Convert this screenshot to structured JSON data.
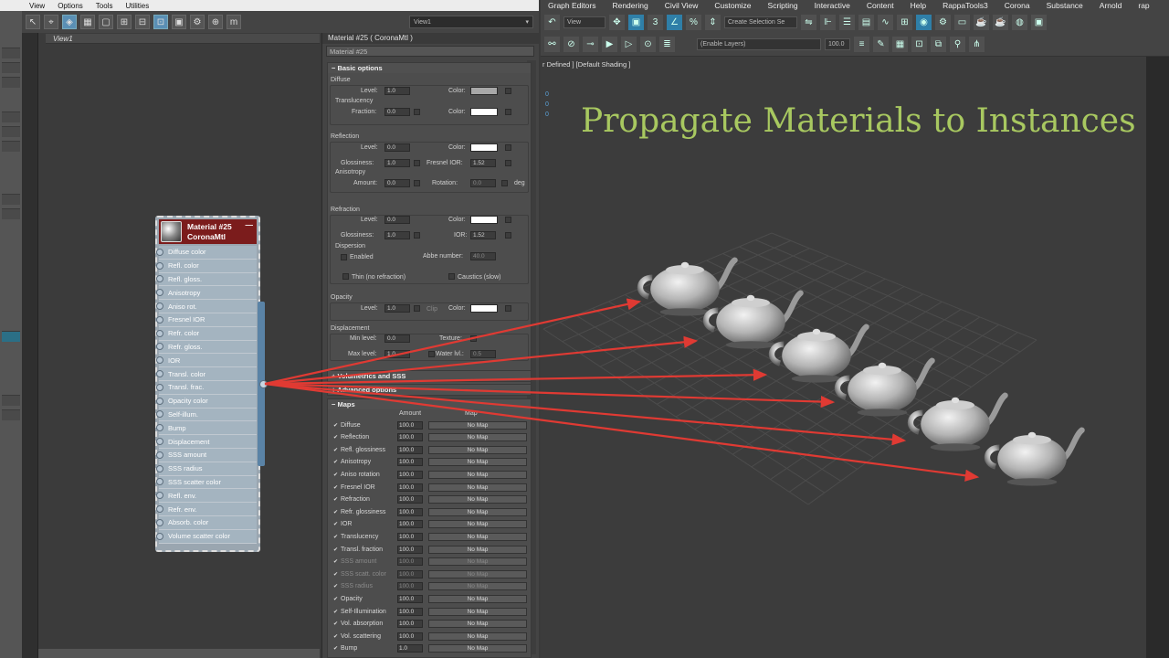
{
  "left_menu": [
    "View",
    "Options",
    "Tools",
    "Utilities"
  ],
  "view_select": "View1",
  "view_tab": "View1",
  "node": {
    "title": "Material #25",
    "type": "CoronaMtl",
    "minimize": "—",
    "slots": [
      "Diffuse color",
      "Refl. color",
      "Refl. gloss.",
      "Anisotropy",
      "Aniso rot.",
      "Fresnel IOR",
      "Refr. color",
      "Refr. gloss.",
      "IOR",
      "Transl. color",
      "Transl. frac.",
      "Opacity color",
      "Self-illum.",
      "Bump",
      "Displacement",
      "SSS amount",
      "SSS radius",
      "SSS scatter color",
      "Refl. env.",
      "Refr. env.",
      "Absorb. color",
      "Volume scatter color"
    ]
  },
  "panel": {
    "title": "Material #25  ( CoronaMtl )",
    "name": "Material #25",
    "basic_options": "Basic options",
    "diffuse": {
      "group": "Diffuse",
      "level_label": "Level:",
      "level": "1.0",
      "color_label": "Color:"
    },
    "translucency": {
      "group": "Translucency",
      "fraction_label": "Fraction:",
      "fraction": "0.0",
      "color_label": "Color:"
    },
    "reflection": {
      "group": "Reflection",
      "level_label": "Level:",
      "level": "0.0",
      "color_label": "Color:",
      "gloss_label": "Glossiness:",
      "gloss": "1.0",
      "fresnel_label": "Fresnel IOR:",
      "fresnel": "1.52",
      "aniso_group": "Anisotropy",
      "amount_label": "Amount:",
      "amount": "0.0",
      "rotation_label": "Rotation:",
      "rotation": "0.0",
      "deg": "deg"
    },
    "refraction": {
      "group": "Refraction",
      "level_label": "Level:",
      "level": "0.0",
      "color_label": "Color:",
      "gloss_label": "Glossiness:",
      "gloss": "1.0",
      "ior_label": "IOR:",
      "ior": "1.52",
      "dispersion_group": "Dispersion",
      "enabled": "Enabled",
      "abbe_label": "Abbe number:",
      "abbe": "40.0",
      "thin": "Thin (no refraction)",
      "caustics": "Caustics (slow)"
    },
    "opacity": {
      "group": "Opacity",
      "level_label": "Level:",
      "level": "1.0",
      "clip": "Clip",
      "color_label": "Color:"
    },
    "displacement": {
      "group": "Displacement",
      "min_label": "Min level:",
      "min": "0.0",
      "texture_label": "Texture:",
      "max_label": "Max level:",
      "max": "1.0",
      "water_label": "Water lvl.:",
      "water": "0.5"
    },
    "volumetrics": "Volumetrics and SSS",
    "advanced": "Advanced options",
    "maps_title": "Maps",
    "maps_amount_header": "Amount",
    "maps_map_header": "Map",
    "maps": [
      {
        "name": "Diffuse",
        "amount": "100.0",
        "map": "No Map",
        "dim": false
      },
      {
        "name": "Reflection",
        "amount": "100.0",
        "map": "No Map",
        "dim": false
      },
      {
        "name": "Refl. glossiness",
        "amount": "100.0",
        "map": "No Map",
        "dim": false
      },
      {
        "name": "Anisotropy",
        "amount": "100.0",
        "map": "No Map",
        "dim": false
      },
      {
        "name": "Aniso rotation",
        "amount": "100.0",
        "map": "No Map",
        "dim": false
      },
      {
        "name": "Fresnel IOR",
        "amount": "100.0",
        "map": "No Map",
        "dim": false
      },
      {
        "name": "Refraction",
        "amount": "100.0",
        "map": "No Map",
        "dim": false
      },
      {
        "name": "Refr. glossiness",
        "amount": "100.0",
        "map": "No Map",
        "dim": false
      },
      {
        "name": "IOR",
        "amount": "100.0",
        "map": "No Map",
        "dim": false
      },
      {
        "name": "Translucency",
        "amount": "100.0",
        "map": "No Map",
        "dim": false
      },
      {
        "name": "Transl. fraction",
        "amount": "100.0",
        "map": "No Map",
        "dim": false
      },
      {
        "name": "SSS amount",
        "amount": "100.0",
        "map": "No Map",
        "dim": true
      },
      {
        "name": "SSS scatt. color",
        "amount": "100.0",
        "map": "No Map",
        "dim": true
      },
      {
        "name": "SSS radius",
        "amount": "100.0",
        "map": "No Map",
        "dim": true
      },
      {
        "name": "Opacity",
        "amount": "100.0",
        "map": "No Map",
        "dim": false
      },
      {
        "name": "Self-Illumination",
        "amount": "100.0",
        "map": "No Map",
        "dim": false
      },
      {
        "name": "Vol. absorption",
        "amount": "100.0",
        "map": "No Map",
        "dim": false
      },
      {
        "name": "Vol. scattering",
        "amount": "100.0",
        "map": "No Map",
        "dim": false
      },
      {
        "name": "Bump",
        "amount": "1.0",
        "map": "No Map",
        "dim": false
      }
    ]
  },
  "right_menu": [
    "Graph Editors",
    "Rendering",
    "Civil View",
    "Customize",
    "Scripting",
    "Interactive",
    "Content",
    "Help",
    "RappaTools3",
    "Corona",
    "Substance",
    "Arnold",
    "rap"
  ],
  "right_toolbar": {
    "view": "View",
    "selection_set": "Create Selection Se",
    "layers": "(Enable Layers)",
    "zoom": "100.0"
  },
  "viewport": {
    "label": "r Defined ] [Default Shading ]",
    "nums": [
      "0",
      "0",
      "0"
    ]
  },
  "headline": "Propagate Materials to Instances",
  "colors": {
    "arrow": "#e03a33",
    "headline": "#a8c860",
    "node_header": "#7b1c1c"
  }
}
